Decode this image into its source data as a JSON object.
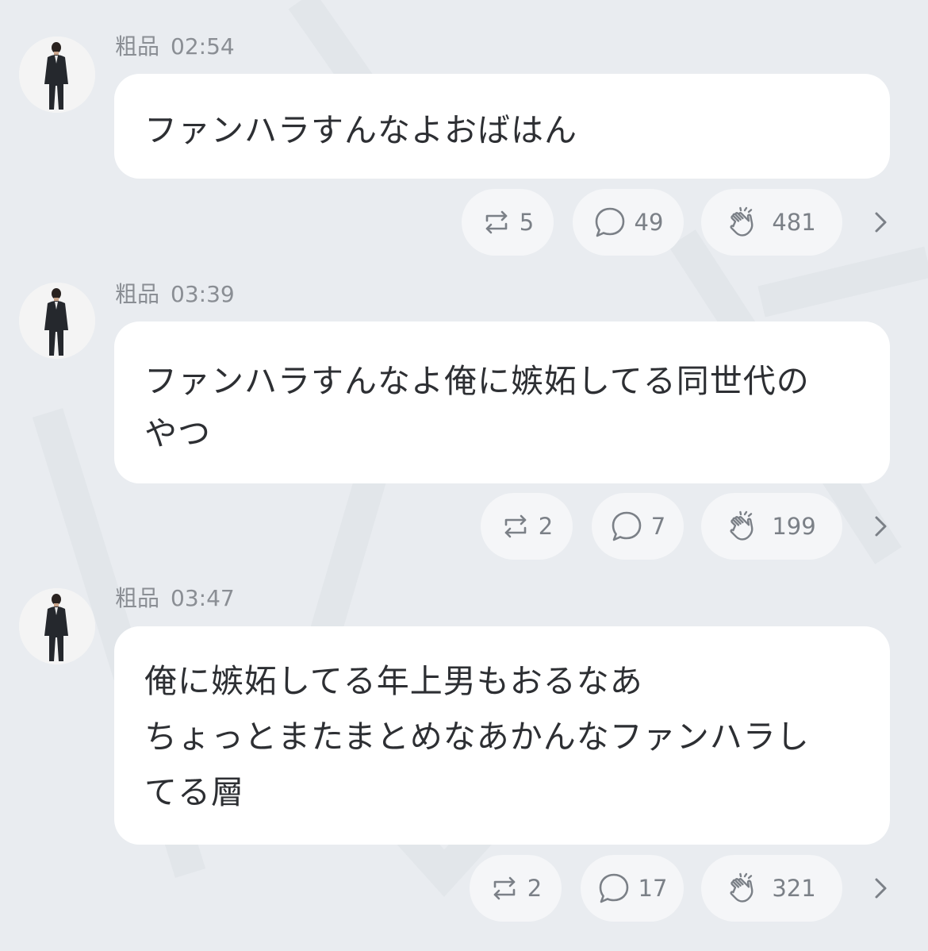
{
  "posts": [
    {
      "author": "粗品",
      "time": "02:54",
      "lines": [
        "ファンハラすんなよおばはん"
      ],
      "repost_count": "5",
      "comment_count": "49",
      "clap_count": "481"
    },
    {
      "author": "粗品",
      "time": "03:39",
      "lines": [
        "ファンハラすんなよ俺に嫉妬してる同世代の",
        "やつ"
      ],
      "repost_count": "2",
      "comment_count": "7",
      "clap_count": "199"
    },
    {
      "author": "粗品",
      "time": "03:47",
      "lines": [
        "俺に嫉妬してる年上男もおるなあ",
        "ちょっとまたまとめなあかんなファンハラし",
        "てる層"
      ],
      "repost_count": "2",
      "comment_count": "17",
      "clap_count": "321"
    }
  ],
  "icons": {
    "repost": "repost-icon",
    "comment": "comment-bubble-icon",
    "clap": "clap-hands-icon",
    "more": "chevron-right-icon",
    "avatar": "avatar"
  },
  "colors": {
    "background": "#e9ecf0",
    "bubble": "#ffffff",
    "pill": "#f5f6f8",
    "meta_text": "#8a8e94",
    "body_text": "#2d2f33",
    "icon": "#7b8087"
  }
}
